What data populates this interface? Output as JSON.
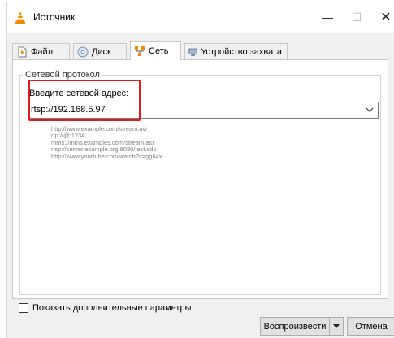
{
  "window": {
    "title": "Источник",
    "minimize": "—",
    "maximize": "☐",
    "close": "✕",
    "icon": "vlc-cone-icon"
  },
  "tabs": [
    {
      "label": "Файл",
      "icon": "file-icon"
    },
    {
      "label": "Диск",
      "icon": "disc-icon"
    },
    {
      "label": "Сеть",
      "icon": "network-icon",
      "active": true
    },
    {
      "label": "Устройство захвата",
      "icon": "capture-device-icon"
    }
  ],
  "network": {
    "group_title": "Сетевой протокол",
    "address_label": "Введите сетевой адрес:",
    "address_value": "rtsp://192.168.5.97",
    "examples": [
      "http://www.example.com/stream.avi",
      "rtp://@:1234",
      "mms://mms.examples.com/stream.asx",
      "rtsp://server.example.org:8080/test.sdp",
      "http://www.yourtube.com/watch?v=gg64x"
    ]
  },
  "footer": {
    "show_more_label": "Показать дополнительные параметры",
    "show_more_checked": false,
    "play_label": "Воспроизвести",
    "cancel_label": "Отмена"
  },
  "colors": {
    "highlight": "#e41b1b",
    "accent_orange": "#f08c00"
  }
}
